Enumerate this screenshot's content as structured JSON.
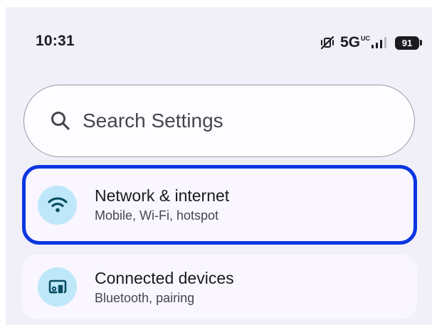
{
  "status_bar": {
    "time": "10:31",
    "network_type": "5G",
    "network_superscript": "UC",
    "battery_level": "91",
    "icons": [
      "mute-vibrate-icon",
      "signal-icon",
      "battery-icon"
    ]
  },
  "search": {
    "placeholder": "Search Settings",
    "icon": "search-icon"
  },
  "settings_items": [
    {
      "title": "Network & internet",
      "subtitle": "Mobile, Wi-Fi, hotspot",
      "icon": "wifi-icon",
      "selected": true
    },
    {
      "title": "Connected devices",
      "subtitle": "Bluetooth, pairing",
      "icon": "connected-devices-icon",
      "selected": false
    }
  ],
  "colors": {
    "background": "#f1eff8",
    "selection_border": "#0b36e0",
    "icon_bg": "#bfe7fa",
    "icon_fg": "#0a4c60",
    "text_primary": "#1b1b1f",
    "text_secondary": "#46464f"
  }
}
